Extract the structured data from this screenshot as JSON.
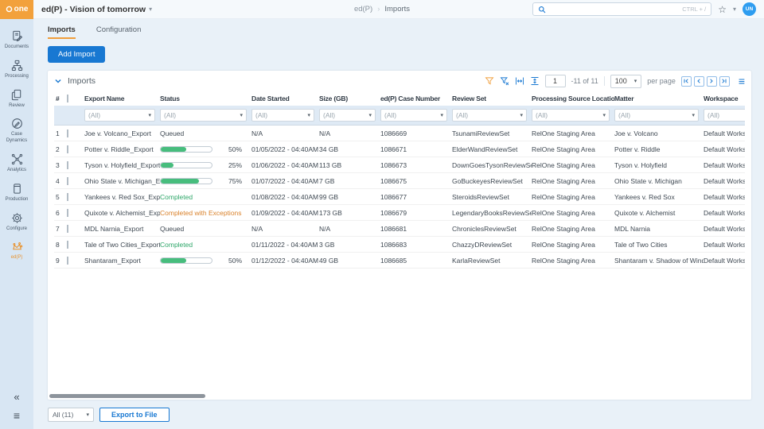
{
  "topbar": {
    "logo_text": "one",
    "title": "ed(P) - Vision of tomorrow",
    "breadcrumb_app": "ed(P)",
    "breadcrumb_sep": "›",
    "breadcrumb_page": "Imports",
    "search_hint": "CTRL + /",
    "avatar_initials": "UN"
  },
  "sidebar": {
    "items": [
      {
        "label": "Documents",
        "icon": "documents-icon"
      },
      {
        "label": "Processing",
        "icon": "processing-icon"
      },
      {
        "label": "Review",
        "icon": "review-icon"
      },
      {
        "label": "Case Dynamics",
        "icon": "case-dynamics-icon"
      },
      {
        "label": "Analytics",
        "icon": "analytics-icon"
      },
      {
        "label": "Production",
        "icon": "production-icon"
      },
      {
        "label": "Configure",
        "icon": "configure-icon"
      },
      {
        "label": "ed(P)",
        "icon": "edp-icon",
        "active": true
      }
    ],
    "collapse_glyph": "«",
    "menu_glyph": "≡"
  },
  "tabs": [
    {
      "label": "Imports",
      "active": true
    },
    {
      "label": "Configuration",
      "active": false
    }
  ],
  "actions": {
    "add_import": "Add Import"
  },
  "grid": {
    "title": "Imports",
    "toolbar": {
      "filter_icons": [
        "filter-icon",
        "clear-filter-icon",
        "fit-width-icon",
        "fit-height-icon"
      ],
      "page_value": "1",
      "range_label": "-11 of 11",
      "page_size": "100",
      "per_page_label": "per page",
      "nav": [
        "first-page-icon",
        "prev-page-icon",
        "next-page-icon",
        "last-page-icon"
      ]
    },
    "filter_placeholder": "(All)",
    "columns": [
      {
        "key": "num",
        "label": "#"
      },
      {
        "key": "cb",
        "label": ""
      },
      {
        "key": "name",
        "label": "Export Name"
      },
      {
        "key": "status",
        "label": "Status"
      },
      {
        "key": "date",
        "label": "Date Started"
      },
      {
        "key": "size",
        "label": "Size (GB)"
      },
      {
        "key": "case",
        "label": "ed(P) Case Number"
      },
      {
        "key": "review",
        "label": "Review Set"
      },
      {
        "key": "source",
        "label": "Processing Source Location"
      },
      {
        "key": "matter",
        "label": "Matter"
      },
      {
        "key": "workspace",
        "label": "Workspace"
      }
    ],
    "rows": [
      {
        "num": "1",
        "name": "Joe v. Volcano_Export",
        "status": {
          "kind": "queued",
          "label": "Queued"
        },
        "date": "N/A",
        "size": "N/A",
        "case": "1086669",
        "review": "TsunamiReviewSet",
        "source": "RelOne Staging Area",
        "matter": "Joe v. Volcano",
        "workspace": "Default Workspace"
      },
      {
        "num": "2",
        "name": "Potter v. Riddle_Export",
        "status": {
          "kind": "progress",
          "pct": 50,
          "label": "50%"
        },
        "date": "01/05/2022 - 04:40AM",
        "size": "34 GB",
        "case": "1086671",
        "review": "ElderWandReviewSet",
        "source": "RelOne Staging Area",
        "matter": "Potter v. Riddle",
        "workspace": "Default Workspace"
      },
      {
        "num": "3",
        "name": "Tyson v. Holyfield_Export",
        "status": {
          "kind": "progress",
          "pct": 25,
          "label": "25%"
        },
        "date": "01/06/2022 - 04:40AM",
        "size": "113 GB",
        "case": "1086673",
        "review": "DownGoesTysonReviewSet",
        "source": "RelOne Staging Area",
        "matter": "Tyson v. Holyfield",
        "workspace": "Default Workspace"
      },
      {
        "num": "4",
        "name": "Ohio State v. Michigan_Export",
        "status": {
          "kind": "progress",
          "pct": 75,
          "label": "75%"
        },
        "date": "01/07/2022 - 04:40AM",
        "size": "7 GB",
        "case": "1086675",
        "review": "GoBuckeyesReviewSet",
        "source": "RelOne Staging Area",
        "matter": "Ohio State v. Michigan",
        "workspace": "Default Workspace"
      },
      {
        "num": "5",
        "name": "Yankees v. Red Sox_Export",
        "status": {
          "kind": "completed",
          "label": "Completed"
        },
        "date": "01/08/2022 - 04:40AM",
        "size": "99 GB",
        "case": "1086677",
        "review": "SteroidsReviewSet",
        "source": "RelOne Staging Area",
        "matter": "Yankees v. Red Sox",
        "workspace": "Default Workspace"
      },
      {
        "num": "6",
        "name": "Quixote v. Alchemist_Export",
        "status": {
          "kind": "completed_exceptions",
          "label": "Completed with Exceptions"
        },
        "date": "01/09/2022 - 04:40AM",
        "size": "173 GB",
        "case": "1086679",
        "review": "LegendaryBooksReviewSet",
        "source": "RelOne Staging Area",
        "matter": "Quixote v. Alchemist",
        "workspace": "Default Workspace"
      },
      {
        "num": "7",
        "name": "MDL Narnia_Export",
        "status": {
          "kind": "queued",
          "label": "Queued"
        },
        "date": "N/A",
        "size": "N/A",
        "case": "1086681",
        "review": "ChroniclesReviewSet",
        "source": "RelOne Staging Area",
        "matter": "MDL Narnia",
        "workspace": "Default Workspace"
      },
      {
        "num": "8",
        "name": "Tale of Two Cities_Export",
        "status": {
          "kind": "completed",
          "label": "Completed"
        },
        "date": "01/11/2022 - 04:40AM",
        "size": "3 GB",
        "case": "1086683",
        "review": "ChazzyDReviewSet",
        "source": "RelOne Staging Area",
        "matter": "Tale of Two Cities",
        "workspace": "Default Workspace"
      },
      {
        "num": "9",
        "name": "Shantaram_Export",
        "status": {
          "kind": "progress",
          "pct": 50,
          "label": "50%"
        },
        "date": "01/12/2022 - 04:40AM",
        "size": "49 GB",
        "case": "1086685",
        "review": "KarlaReviewSet",
        "source": "RelOne Staging Area",
        "matter": "Shantaram v. Shadow of Wind",
        "workspace": "Default Workspace"
      }
    ]
  },
  "footer": {
    "scope_label": "All (11)",
    "export_label": "Export to File"
  },
  "colors": {
    "accent_blue": "#1878d2",
    "accent_orange": "#f2a13c",
    "progress_green": "#47bd7d",
    "status_completed": "#2fa76a",
    "status_exceptions": "#d9822b",
    "sidebar_bg": "#d8e6f3"
  }
}
